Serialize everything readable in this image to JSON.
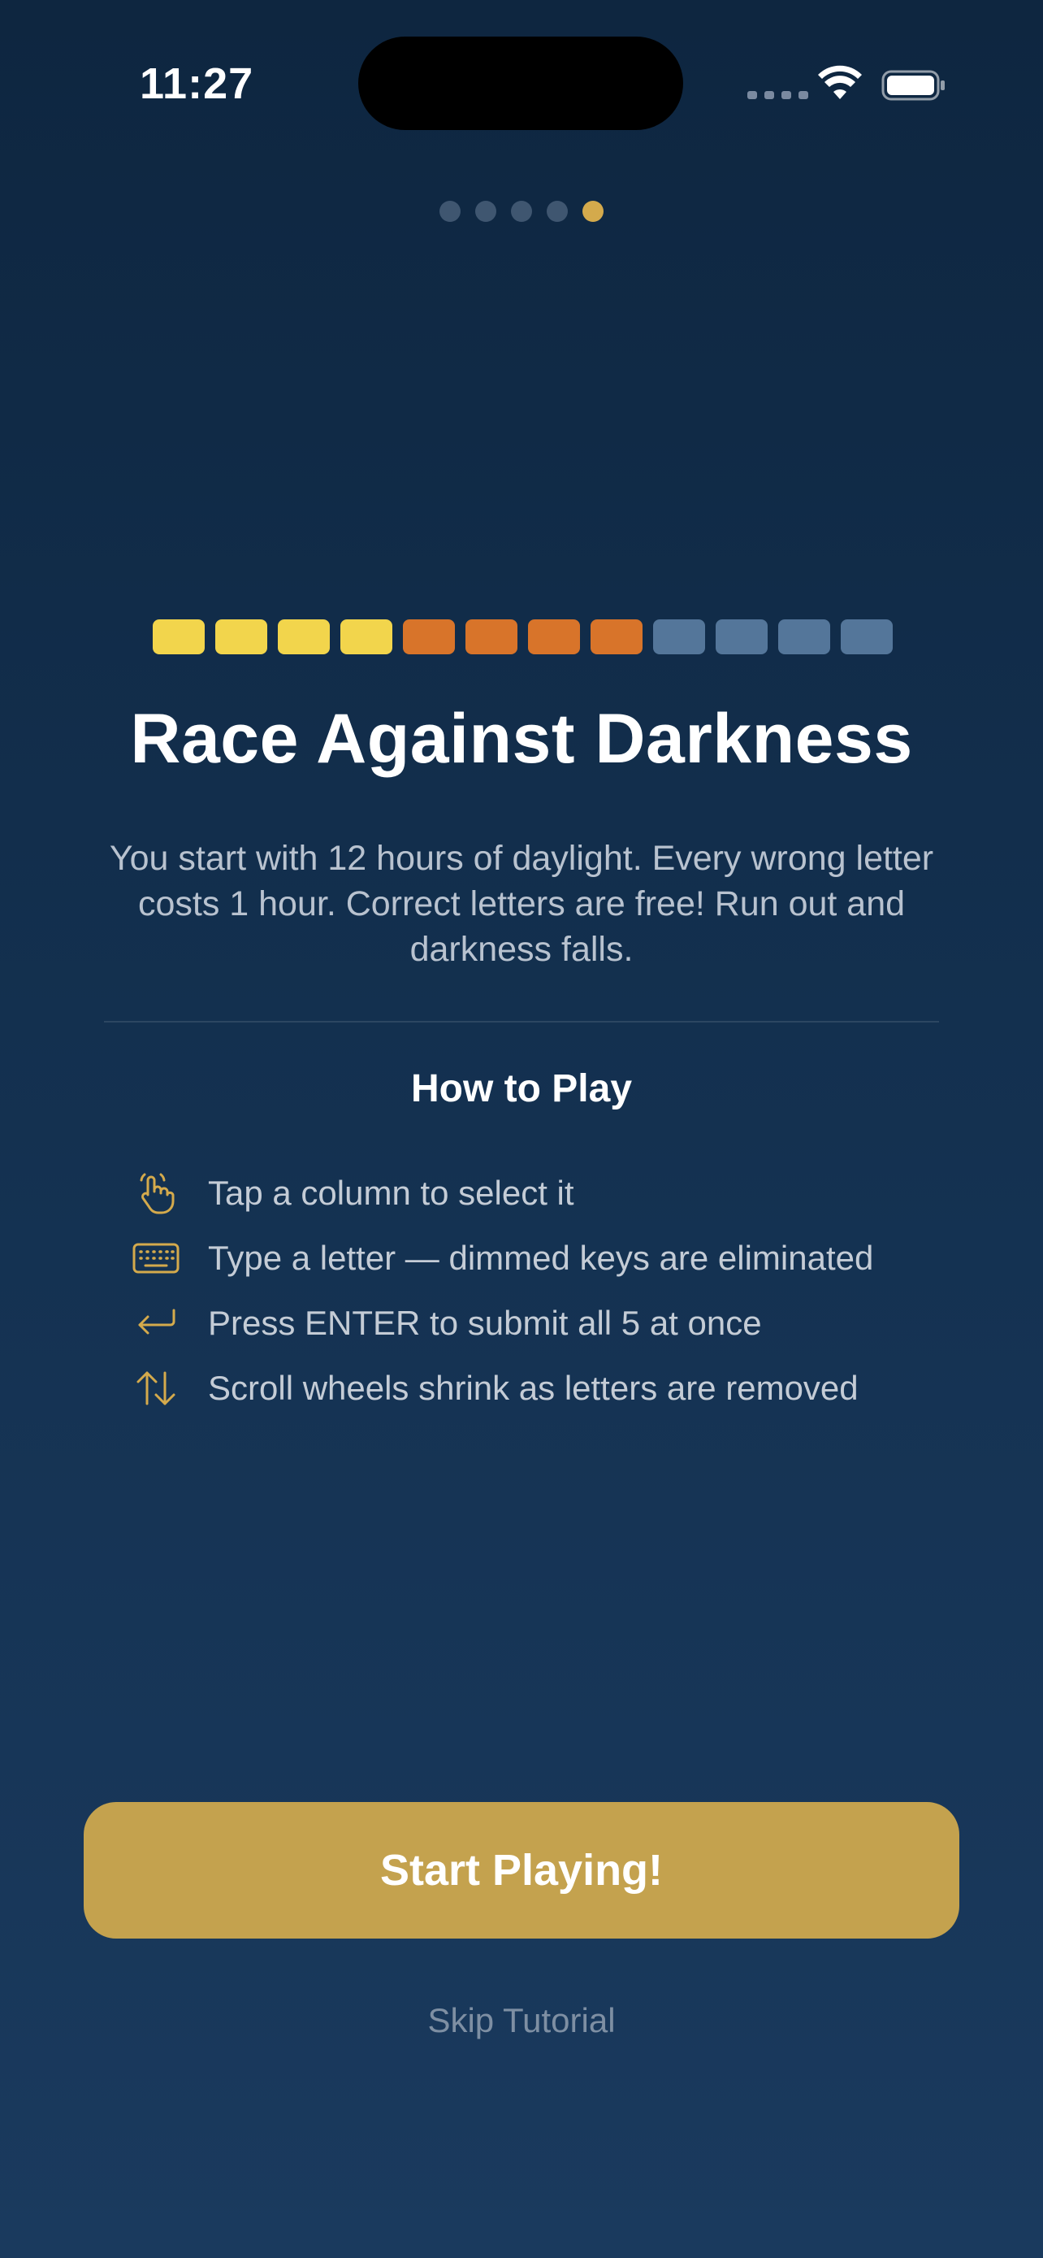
{
  "status_bar": {
    "time": "11:27"
  },
  "pagination": {
    "total": 5,
    "active_index": 4
  },
  "daylight_bar": {
    "total_hours": 12,
    "colors": {
      "bright": "#f2d54c",
      "dusk": "#d8742a",
      "dark": "#54769a"
    },
    "segments": [
      "bright",
      "bright",
      "bright",
      "bright",
      "dusk",
      "dusk",
      "dusk",
      "dusk",
      "dark",
      "dark",
      "dark",
      "dark"
    ]
  },
  "content": {
    "title": "Race Against Darkness",
    "description": "You start with 12 hours of daylight. Every wrong letter costs 1 hour. Correct letters are free! Run out and darkness falls."
  },
  "how_to_play": {
    "title": "How to Play",
    "icon_color": "#d4aa4c",
    "rules": [
      {
        "icon": "tap-hand-icon",
        "text": "Tap a column to select it"
      },
      {
        "icon": "keyboard-icon",
        "text": "Type a letter — dimmed keys are eliminated"
      },
      {
        "icon": "return-arrow-icon",
        "text": "Press ENTER to submit all 5 at once"
      },
      {
        "icon": "up-down-arrows-icon",
        "text": "Scroll wheels shrink as letters are removed"
      }
    ]
  },
  "actions": {
    "start_label": "Start Playing!",
    "skip_label": "Skip Tutorial",
    "accent_color": "#c4a24e"
  }
}
